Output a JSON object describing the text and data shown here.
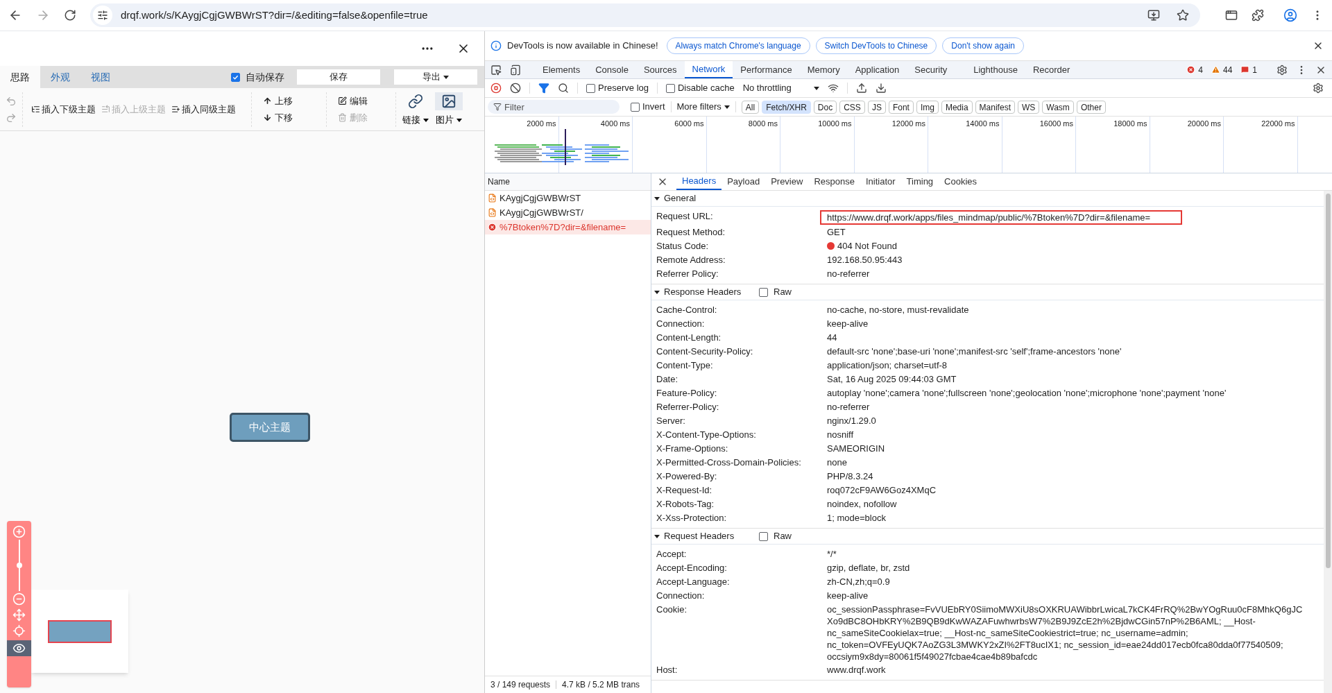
{
  "browser": {
    "url": "drqf.work/s/KAygjCgjGWBWrST?dir=/&editing=false&openfile=true",
    "forward_disabled": true
  },
  "mindmap": {
    "tabs": [
      {
        "label": "思路",
        "selected": true
      },
      {
        "label": "外观",
        "selected": false
      },
      {
        "label": "视图",
        "selected": false
      }
    ],
    "autosave": {
      "label": "自动保存",
      "checked": true
    },
    "save_button": "保存",
    "export_button": "导出",
    "history": [
      {
        "kind": "undo",
        "disabled": true
      },
      {
        "kind": "redo",
        "disabled": true
      }
    ],
    "insert_items": [
      {
        "kind": "child",
        "label": "插入下级主题",
        "disabled": false
      },
      {
        "kind": "parent",
        "label": "插入上级主题",
        "disabled": true
      },
      {
        "kind": "sibling",
        "label": "插入同级主题",
        "disabled": false
      }
    ],
    "move_items": [
      {
        "kind": "up",
        "label": "上移",
        "disabled": false
      },
      {
        "kind": "down",
        "label": "下移",
        "disabled": false
      }
    ],
    "edit_items": [
      {
        "kind": "edit",
        "label": "编辑",
        "disabled": false
      },
      {
        "kind": "delete",
        "label": "删除",
        "disabled": true
      }
    ],
    "media_items": [
      {
        "kind": "link",
        "label": "链接",
        "highlighted": false
      },
      {
        "kind": "image",
        "label": "图片",
        "highlighted": true
      }
    ],
    "center_node": "中心主题",
    "zoom": {
      "level": 0.5
    },
    "eye_active": true
  },
  "devtools": {
    "infobar": {
      "message": "DevTools is now available in Chinese!",
      "buttons": [
        "Always match Chrome's language",
        "Switch DevTools to Chinese",
        "Don't show again"
      ]
    },
    "tabs": [
      {
        "label": "Elements",
        "selected": false
      },
      {
        "label": "Console",
        "selected": false
      },
      {
        "label": "Sources",
        "selected": false
      },
      {
        "label": "Network",
        "selected": true
      },
      {
        "label": "Performance",
        "selected": false
      },
      {
        "label": "Memory",
        "selected": false
      },
      {
        "label": "Application",
        "selected": false
      },
      {
        "label": "Security",
        "selected": false
      },
      {
        "label": "Lighthouse",
        "selected": false
      },
      {
        "label": "Recorder",
        "selected": false
      }
    ],
    "counts": {
      "errors": "4",
      "warnings": "44",
      "issues": "1"
    },
    "preserve_log": {
      "label": "Preserve log",
      "checked": false
    },
    "disable_cache": {
      "label": "Disable cache",
      "checked": false
    },
    "throttling": "No throttling",
    "filter": {
      "placeholder": "Filter"
    },
    "invert": {
      "label": "Invert",
      "checked": false
    },
    "more_filters": "More filters",
    "type_filters": [
      {
        "label": "All",
        "selected": false
      },
      {
        "label": "Fetch/XHR",
        "selected": true
      },
      {
        "label": "Doc",
        "selected": false
      },
      {
        "label": "CSS",
        "selected": false
      },
      {
        "label": "JS",
        "selected": false
      },
      {
        "label": "Font",
        "selected": false
      },
      {
        "label": "Img",
        "selected": false
      },
      {
        "label": "Media",
        "selected": false
      },
      {
        "label": "Manifest",
        "selected": false
      },
      {
        "label": "WS",
        "selected": false
      },
      {
        "label": "Wasm",
        "selected": false
      },
      {
        "label": "Other",
        "selected": false
      }
    ],
    "timeline_ticks": [
      "2000 ms",
      "4000 ms",
      "6000 ms",
      "8000 ms",
      "10000 ms",
      "12000 ms",
      "14000 ms",
      "16000 ms",
      "18000 ms",
      "20000 ms",
      "22000 ms"
    ],
    "name_header": "Name",
    "requests": [
      {
        "name": "KAygjCgjGWBWrST",
        "error": false,
        "selected": false
      },
      {
        "name": "KAygjCgjGWBWrST/",
        "error": false,
        "selected": false
      },
      {
        "name": "%7Btoken%7D?dir=&filename=",
        "error": true,
        "selected": true
      }
    ],
    "footer": [
      "3 / 149 requests",
      "4.7 kB / 5.2 MB trans"
    ],
    "detail_tabs": [
      {
        "label": "Headers",
        "selected": true
      },
      {
        "label": "Payload",
        "selected": false
      },
      {
        "label": "Preview",
        "selected": false
      },
      {
        "label": "Response",
        "selected": false
      },
      {
        "label": "Initiator",
        "selected": false
      },
      {
        "label": "Timing",
        "selected": false
      },
      {
        "label": "Cookies",
        "selected": false
      }
    ],
    "sections": [
      {
        "title": "General",
        "expanded": true,
        "rows": [
          {
            "name": "Request URL:",
            "value": "https://www.drqf.work/apps/files_mindmap/public/%7Btoken%7D?dir=&filename=",
            "highlighted": true
          },
          {
            "name": "Request Method:",
            "value": "GET",
            "highlighted": false
          },
          {
            "name": "Status Code:",
            "value": "404 Not Found",
            "highlighted": false,
            "color": "#e53935"
          },
          {
            "name": "Remote Address:",
            "value": "192.168.50.95:443",
            "highlighted": false
          },
          {
            "name": "Referrer Policy:",
            "value": "no-referrer",
            "highlighted": false
          }
        ]
      },
      {
        "title": "Response Headers",
        "expanded": true,
        "raw": {
          "label": "Raw",
          "checked": false
        },
        "rows": [
          {
            "name": "Cache-Control:",
            "value": "no-cache, no-store, must-revalidate",
            "highlighted": false
          },
          {
            "name": "Connection:",
            "value": "keep-alive",
            "highlighted": false
          },
          {
            "name": "Content-Length:",
            "value": "44",
            "highlighted": false
          },
          {
            "name": "Content-Security-Policy:",
            "value": "default-src 'none';base-uri 'none';manifest-src 'self';frame-ancestors 'none'",
            "highlighted": false
          },
          {
            "name": "Content-Type:",
            "value": "application/json; charset=utf-8",
            "highlighted": false
          },
          {
            "name": "Date:",
            "value": "Sat, 16 Aug 2025 09:44:03 GMT",
            "highlighted": false
          },
          {
            "name": "Feature-Policy:",
            "value": "autoplay 'none';camera 'none';fullscreen 'none';geolocation 'none';microphone 'none';payment 'none'",
            "highlighted": false
          },
          {
            "name": "Referrer-Policy:",
            "value": "no-referrer",
            "highlighted": false
          },
          {
            "name": "Server:",
            "value": "nginx/1.29.0",
            "highlighted": false
          },
          {
            "name": "X-Content-Type-Options:",
            "value": "nosniff",
            "highlighted": false
          },
          {
            "name": "X-Frame-Options:",
            "value": "SAMEORIGIN",
            "highlighted": false
          },
          {
            "name": "X-Permitted-Cross-Domain-Policies:",
            "value": "none",
            "highlighted": false
          },
          {
            "name": "X-Powered-By:",
            "value": "PHP/8.3.24",
            "highlighted": false
          },
          {
            "name": "X-Request-Id:",
            "value": "roq072cF9AW6Goz4XMqC",
            "highlighted": false
          },
          {
            "name": "X-Robots-Tag:",
            "value": "noindex, nofollow",
            "highlighted": false
          },
          {
            "name": "X-Xss-Protection:",
            "value": "1; mode=block",
            "highlighted": false
          }
        ]
      },
      {
        "title": "Request Headers",
        "expanded": true,
        "raw": {
          "label": "Raw",
          "checked": false
        },
        "rows": [
          {
            "name": "Accept:",
            "value": "*/*",
            "highlighted": false
          },
          {
            "name": "Accept-Encoding:",
            "value": "gzip, deflate, br, zstd",
            "highlighted": false
          },
          {
            "name": "Accept-Language:",
            "value": "zh-CN,zh;q=0.9",
            "highlighted": false
          },
          {
            "name": "Connection:",
            "value": "keep-alive",
            "highlighted": false
          },
          {
            "name": "Cookie:",
            "value": "oc_sessionPassphrase=FvVUEbRY0SiimoMWXiU8sOXKRUAWibbrLwicaL7kCK4FrRQ%2BwYOgRuu0cF8MhkQ6gJCXo9dBC8OHbKRY%2B9QB9dKwWAZAFuwhwrbsW7%2B9J9ZcE2h%2BjdwCGin57nP%2B6AML; __Host-nc_sameSiteCookielax=true; __Host-nc_sameSiteCookiestrict=true; nc_username=admin; nc_token=OVFEyUQK7AoZG3L3MWKY2xZI%2FT8ucIX1; nc_session_id=eae24dd017ecb0fca80dda0f77540509; occsiym9x8dy=80061f5f49027fcbae4cae4b89bafcdc",
            "highlighted": false
          },
          {
            "name": "Host:",
            "value": "www.drqf.work",
            "highlighted": false
          }
        ]
      }
    ]
  }
}
